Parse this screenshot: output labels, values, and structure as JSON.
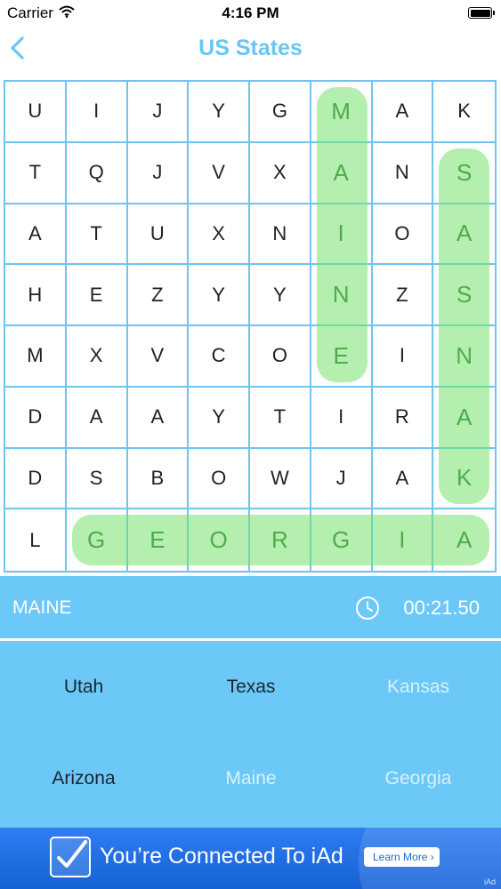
{
  "status_bar": {
    "carrier": "Carrier",
    "time": "4:16 PM"
  },
  "nav": {
    "title": "US States"
  },
  "grid": {
    "rows": [
      [
        "U",
        "I",
        "J",
        "Y",
        "G",
        "M",
        "A",
        "K"
      ],
      [
        "T",
        "Q",
        "J",
        "V",
        "X",
        "A",
        "N",
        "S"
      ],
      [
        "A",
        "T",
        "U",
        "X",
        "N",
        "I",
        "O",
        "A"
      ],
      [
        "H",
        "E",
        "Z",
        "Y",
        "Y",
        "N",
        "Z",
        "S"
      ],
      [
        "M",
        "X",
        "V",
        "C",
        "O",
        "E",
        "I",
        "N"
      ],
      [
        "D",
        "A",
        "A",
        "Y",
        "T",
        "I",
        "R",
        "A"
      ],
      [
        "D",
        "S",
        "B",
        "O",
        "W",
        "J",
        "A",
        "K"
      ],
      [
        "L",
        "G",
        "E",
        "O",
        "R",
        "G",
        "I",
        "A"
      ]
    ],
    "found_words": [
      {
        "word": "MAINE",
        "start": [
          0,
          5
        ],
        "end": [
          4,
          5
        ]
      },
      {
        "word": "KANSAS",
        "start": [
          6,
          7
        ],
        "end": [
          1,
          7
        ]
      },
      {
        "word": "GEORGIA",
        "start": [
          7,
          1
        ],
        "end": [
          7,
          7
        ]
      }
    ],
    "highlight_color": "#78e16e"
  },
  "status": {
    "current_word": "MAINE",
    "timer": "00:21.50"
  },
  "words": [
    {
      "label": "Utah",
      "found": false
    },
    {
      "label": "Texas",
      "found": false
    },
    {
      "label": "Kansas",
      "found": true
    },
    {
      "label": "Arizona",
      "found": false
    },
    {
      "label": "Maine",
      "found": true
    },
    {
      "label": "Georgia",
      "found": true
    }
  ],
  "ad": {
    "text": "You’re Connected To iAd",
    "button": "Learn More",
    "badge": "iAd"
  },
  "colors": {
    "accent": "#66c7f4",
    "panel": "#6cc8f7",
    "grid_line": "#6ec5ef",
    "ad": "#1f6fe3"
  }
}
